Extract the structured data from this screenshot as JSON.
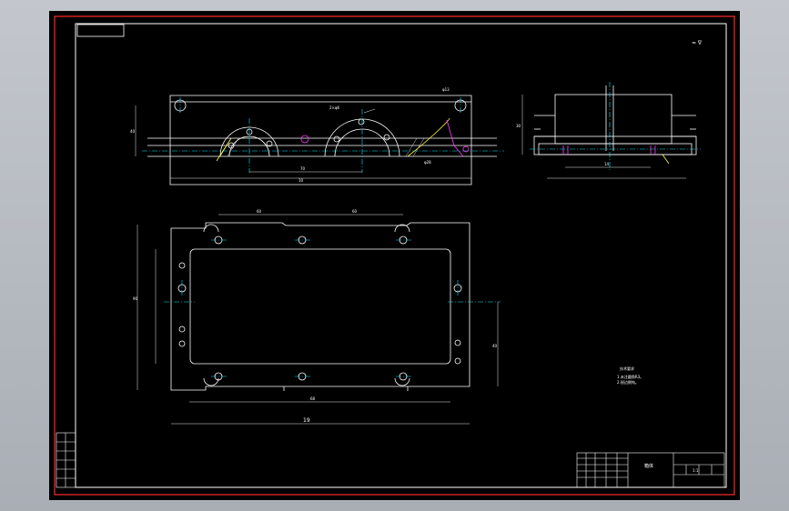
{
  "drawing": {
    "roughness_note": "≈ ∇",
    "callouts": [
      "2×φ6",
      "φ13",
      "φ28"
    ],
    "front_dims": [
      "40",
      "70",
      "10"
    ],
    "plan_dims": [
      "60",
      "60",
      "90",
      "68",
      "19",
      "40"
    ],
    "side_dims": [
      "30",
      "14"
    ],
    "tech_heading": "技术要求",
    "tech_lines": [
      "1.未注圆角R3。",
      "2.锐边倒钝。"
    ],
    "title_name": "箱体",
    "scale": "1:1"
  },
  "colors": {
    "frame": "#ff2a2a",
    "line": "#ffffff",
    "dim": "#e9e9e9",
    "center": "#00e5ff",
    "accent_yellow": "#ffff3c",
    "accent_magenta": "#ff3cff"
  }
}
